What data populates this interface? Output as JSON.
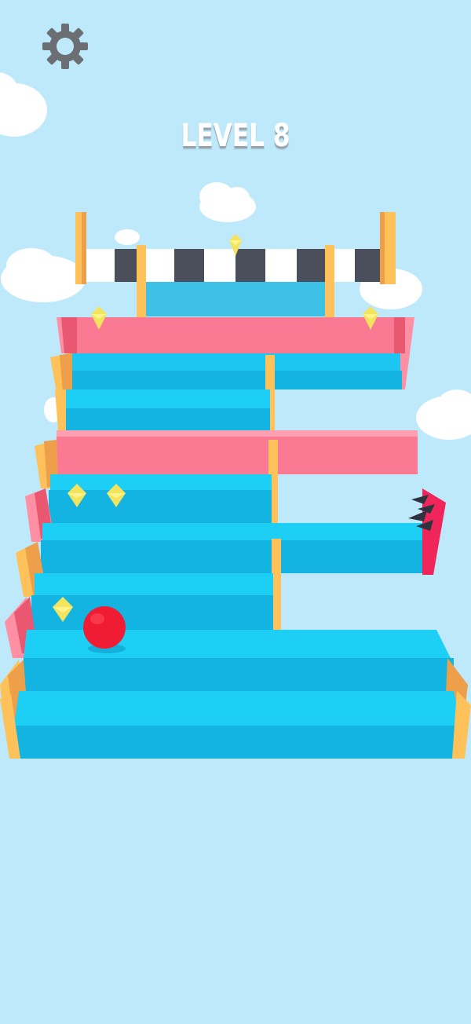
{
  "hud": {
    "level_label": "LEVEL 8",
    "settings_icon": "gear-icon"
  },
  "colors": {
    "sky": "#bde9fb",
    "step_top": "#1dcff5",
    "step_front": "#14b4e2",
    "pink_top": "#ff8fa3",
    "pink_front": "#fb7a93",
    "rail": "#ffc25a",
    "rail_side": "#eda049",
    "ball": "#ef1c34",
    "gem": "#f4e35c",
    "spikes_wall": "#f0265a",
    "finish_dark": "#4b4f5c",
    "finish_light": "#ffffff"
  }
}
